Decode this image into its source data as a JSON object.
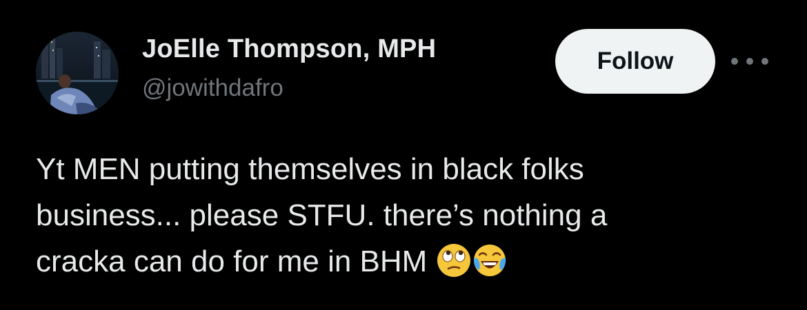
{
  "author": {
    "display_name": "JoElle Thompson, MPH",
    "handle": "@jowithdafro",
    "avatar_icon": "profile-photo"
  },
  "actions": {
    "follow_label": "Follow",
    "more_icon": "more-horizontal-icon"
  },
  "tweet": {
    "lines": [
      "Yt MEN putting themselves in black folks",
      "business... please STFU. there’s nothing a",
      "cracka can do for me in BHM"
    ],
    "emojis": [
      "face-with-rolling-eyes",
      "face-with-tears-of-joy"
    ]
  },
  "colors": {
    "background": "#000000",
    "primary_text": "#e7e9ea",
    "secondary_text": "#71767b",
    "follow_bg": "#eff3f4",
    "follow_text": "#0f1419"
  }
}
